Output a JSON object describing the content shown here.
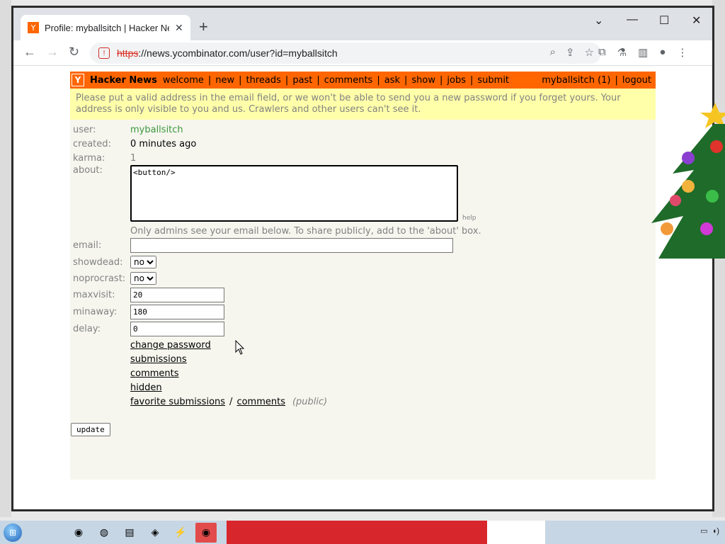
{
  "browser": {
    "tab_title": "Profile: myballsitch | Hacker News",
    "tab_favicon": "Y",
    "new_tab_icon": "plus-icon",
    "url_scheme": "https",
    "url_rest": "://news.ycombinator.com/user?id=myballsitch"
  },
  "hn": {
    "logo": "Y",
    "title": "Hacker News",
    "nav": [
      "welcome",
      "new",
      "threads",
      "past",
      "comments",
      "ask",
      "show",
      "jobs",
      "submit"
    ],
    "user": "myballsitch",
    "karma_badge": "(1)",
    "logout": "logout",
    "header_color": "#ff6600"
  },
  "notice": {
    "text": "Please put a valid address in the email field, or we won't be able to send you a new password if you forget yours. Your address is only visible to you and us. Crawlers and other users can't see it."
  },
  "profile": {
    "user_label": "user:",
    "user_value": "myballsitch",
    "created_label": "created:",
    "created_value": "0 minutes ago",
    "karma_label": "karma:",
    "karma_value": "1",
    "about_label": "about:",
    "about_value": "<button/>",
    "help": "help",
    "email_hint": "Only admins see your email below. To share publicly, add to the 'about' box.",
    "email_label": "email:",
    "email_value": "",
    "showdead_label": "showdead:",
    "showdead_value": "no",
    "noprocrast_label": "noprocrast:",
    "noprocrast_value": "no",
    "maxvisit_label": "maxvisit:",
    "maxvisit_value": "20",
    "minaway_label": "minaway:",
    "minaway_value": "180",
    "delay_label": "delay:",
    "delay_value": "0",
    "links": {
      "change_password": "change password",
      "submissions": "submissions",
      "comments": "comments",
      "hidden": "hidden",
      "favorite_submissions": "favorite submissions",
      "slash": "/",
      "favorite_comments": "comments",
      "public": "(public)"
    },
    "update": "update"
  }
}
